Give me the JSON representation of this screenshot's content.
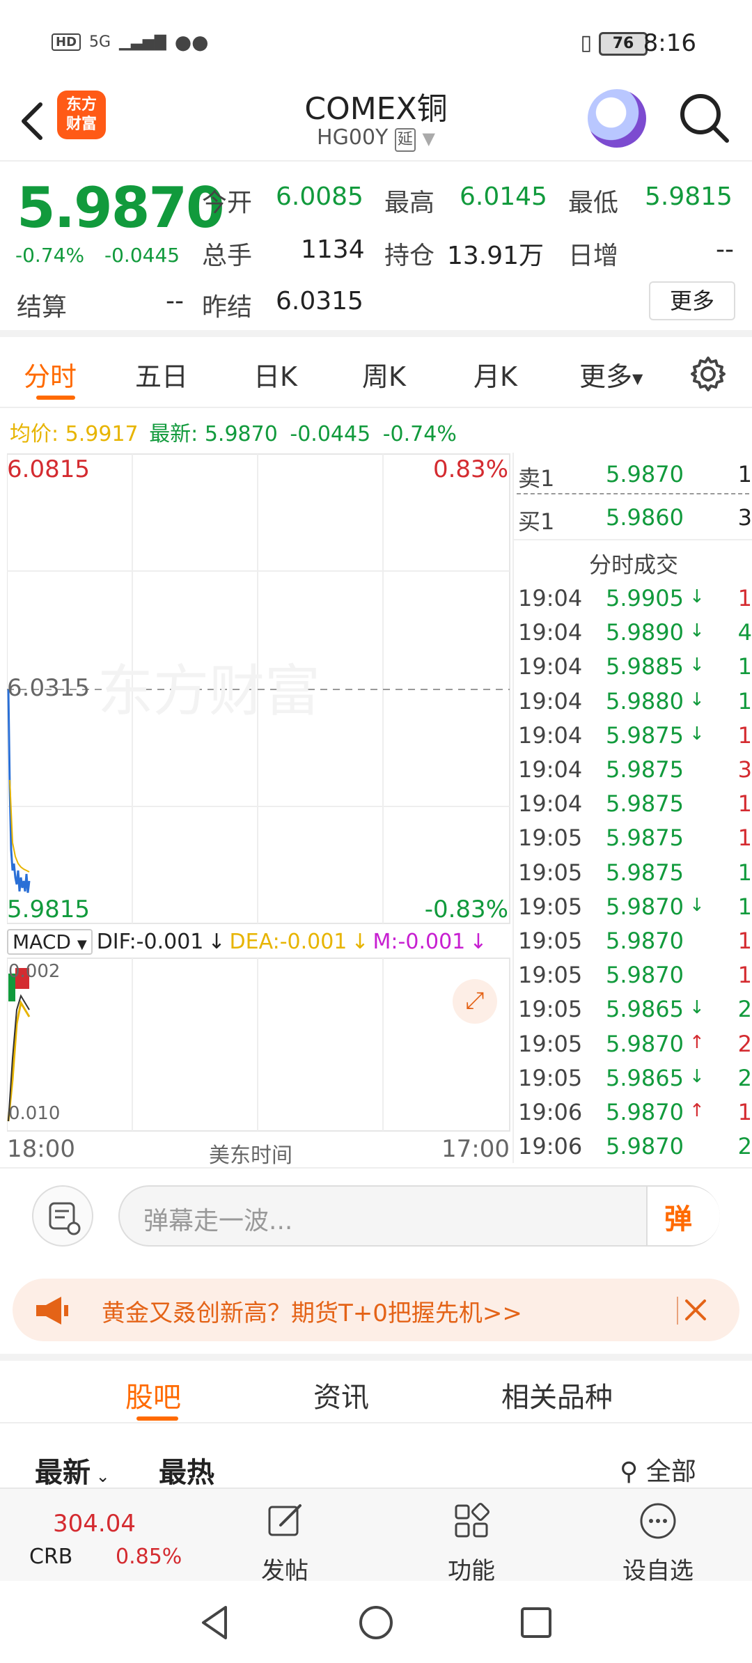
{
  "status": {
    "hd": "HD",
    "signal": "5G",
    "battery": "76",
    "time": "8:16"
  },
  "header": {
    "title": "COMEX铜",
    "code": "HG00Y",
    "delay_tag": "延",
    "logo_line1": "东方",
    "logo_line2": "财富"
  },
  "quote": {
    "price": "5.9870",
    "change_pct": "-0.74%",
    "change": "-0.0445",
    "open_label": "今开",
    "open": "6.0085",
    "high_label": "最高",
    "high": "6.0145",
    "low_label": "最低",
    "low": "5.9815",
    "volume_label": "总手",
    "volume": "1134",
    "oi_label": "持仓",
    "oi": "13.91万",
    "daily_inc_label": "日增",
    "daily_inc": "--",
    "settle_label": "结算",
    "settle": "--",
    "prev_settle_label": "昨结",
    "prev_settle": "6.0315",
    "more_label": "更多"
  },
  "tabs": [
    "分时",
    "五日",
    "日K",
    "周K",
    "月K",
    "更多"
  ],
  "avg": {
    "avg_label": "均价:",
    "avg_value": "5.9917",
    "latest_label": "最新:",
    "latest_value": "5.9870",
    "latest_change": "-0.0445",
    "latest_pct": "-0.74%"
  },
  "chart": {
    "top_price": "6.0815",
    "top_pct": "0.83%",
    "mid_price": "6.0315",
    "bottom_price": "5.9815",
    "bottom_pct": "-0.83%",
    "watermark": "东方财富",
    "macd_select": "MACD",
    "dif": "DIF:-0.001",
    "dea": "DEA:-0.001",
    "m": "M:-0.001",
    "macd_top": "0.002",
    "macd_bottom": "0.010",
    "time_start": "18:00",
    "time_mid": "美东时间",
    "time_end": "17:00"
  },
  "orderbook": {
    "sell1_label": "卖1",
    "sell1_price": "5.9870",
    "sell1_vol": "1",
    "buy1_label": "买1",
    "buy1_price": "5.9860",
    "buy1_vol": "3",
    "trades_title": "分时成交"
  },
  "trades": [
    {
      "time": "19:04",
      "price": "5.9905",
      "arrow": "↓",
      "vol": "1",
      "vcolor": "r"
    },
    {
      "time": "19:04",
      "price": "5.9890",
      "arrow": "↓",
      "vol": "4",
      "vcolor": "g"
    },
    {
      "time": "19:04",
      "price": "5.9885",
      "arrow": "↓",
      "vol": "1",
      "vcolor": "g"
    },
    {
      "time": "19:04",
      "price": "5.9880",
      "arrow": "↓",
      "vol": "1",
      "vcolor": "g"
    },
    {
      "time": "19:04",
      "price": "5.9875",
      "arrow": "↓",
      "vol": "1",
      "vcolor": "r"
    },
    {
      "time": "19:04",
      "price": "5.9875",
      "arrow": "",
      "vol": "3",
      "vcolor": "r"
    },
    {
      "time": "19:04",
      "price": "5.9875",
      "arrow": "",
      "vol": "1",
      "vcolor": "r"
    },
    {
      "time": "19:05",
      "price": "5.9875",
      "arrow": "",
      "vol": "1",
      "vcolor": "r"
    },
    {
      "time": "19:05",
      "price": "5.9875",
      "arrow": "",
      "vol": "1",
      "vcolor": "g"
    },
    {
      "time": "19:05",
      "price": "5.9870",
      "arrow": "↓",
      "vol": "1",
      "vcolor": "g"
    },
    {
      "time": "19:05",
      "price": "5.9870",
      "arrow": "",
      "vol": "1",
      "vcolor": "r"
    },
    {
      "time": "19:05",
      "price": "5.9870",
      "arrow": "",
      "vol": "1",
      "vcolor": "r"
    },
    {
      "time": "19:05",
      "price": "5.9865",
      "arrow": "↓",
      "vol": "2",
      "vcolor": "g"
    },
    {
      "time": "19:05",
      "price": "5.9870",
      "arrow": "↑",
      "vol": "2",
      "vcolor": "r"
    },
    {
      "time": "19:05",
      "price": "5.9865",
      "arrow": "↓",
      "vol": "2",
      "vcolor": "g"
    },
    {
      "time": "19:06",
      "price": "5.9870",
      "arrow": "↑",
      "vol": "1",
      "vcolor": "r"
    },
    {
      "time": "19:06",
      "price": "5.9870",
      "arrow": "",
      "vol": "2",
      "vcolor": "g"
    }
  ],
  "comment": {
    "placeholder": "弹幕走一波...",
    "danmu_label": "弹"
  },
  "promo": {
    "text": "黄金又叒创新高？期货T+0把握先机>>"
  },
  "subtabs": [
    "股吧",
    "资讯",
    "相关品种"
  ],
  "filters": {
    "latest": "最新",
    "hot": "最热",
    "all": "全部"
  },
  "bottombar": {
    "index_value": "304.04",
    "index_name": "CRB",
    "index_pct": "0.85%",
    "post_label": "发帖",
    "func_label": "功能",
    "watch_label": "设自选"
  },
  "colors": {
    "accent": "#ff6a00",
    "up": "#d42b30",
    "down": "#119a3c"
  }
}
